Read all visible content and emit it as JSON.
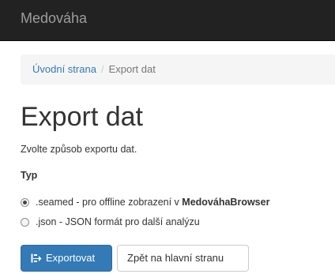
{
  "navbar": {
    "brand": "Medováha"
  },
  "breadcrumb": {
    "home": "Úvodní strana",
    "separator": "/",
    "current": "Export dat"
  },
  "page": {
    "title": "Export dat",
    "description": "Zvolte způsob exportu dat.",
    "type_label": "Typ"
  },
  "options": [
    {
      "text": ".seamed - pro offline zobrazení v ",
      "bold": "MedováhaBrowser",
      "checked": true
    },
    {
      "text": ".json - JSON formát pro další analýzu",
      "bold": "",
      "checked": false
    }
  ],
  "buttons": {
    "export": "Exportovat",
    "back": "Zpět na hlavní stranu"
  },
  "icons": {
    "export": "export-icon"
  },
  "colors": {
    "primary": "#337ab7",
    "navbar": "#222222",
    "link": "#337ab7"
  }
}
